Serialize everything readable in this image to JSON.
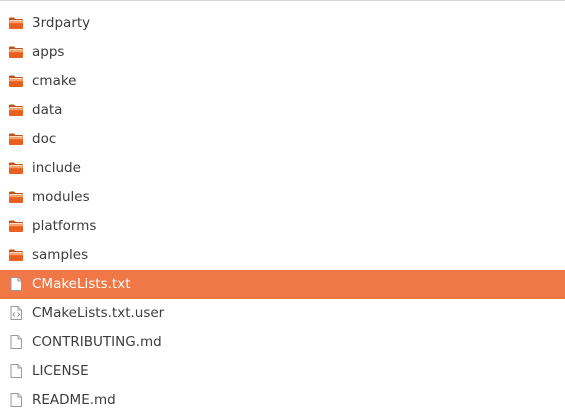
{
  "file_list": {
    "items": [
      {
        "name": "3rdparty",
        "type": "folder",
        "icon": "folder-icon",
        "selected": false
      },
      {
        "name": "apps",
        "type": "folder",
        "icon": "folder-icon",
        "selected": false
      },
      {
        "name": "cmake",
        "type": "folder",
        "icon": "folder-icon",
        "selected": false
      },
      {
        "name": "data",
        "type": "folder",
        "icon": "folder-icon",
        "selected": false
      },
      {
        "name": "doc",
        "type": "folder",
        "icon": "folder-icon",
        "selected": false
      },
      {
        "name": "include",
        "type": "folder",
        "icon": "folder-icon",
        "selected": false
      },
      {
        "name": "modules",
        "type": "folder",
        "icon": "folder-icon",
        "selected": false
      },
      {
        "name": "platforms",
        "type": "folder",
        "icon": "folder-icon",
        "selected": false
      },
      {
        "name": "samples",
        "type": "folder",
        "icon": "folder-icon",
        "selected": false
      },
      {
        "name": "CMakeLists.txt",
        "type": "text-file",
        "icon": "text-file-icon",
        "selected": true
      },
      {
        "name": "CMakeLists.txt.user",
        "type": "xml-file",
        "icon": "xml-file-icon",
        "selected": false
      },
      {
        "name": "CONTRIBUTING.md",
        "type": "text-file",
        "icon": "text-file-icon",
        "selected": false
      },
      {
        "name": "LICENSE",
        "type": "text-file",
        "icon": "text-file-icon",
        "selected": false
      },
      {
        "name": "README.md",
        "type": "text-file",
        "icon": "text-file-icon",
        "selected": false
      }
    ]
  },
  "colors": {
    "selection": "#f07746",
    "folder_top": "#f7a16b",
    "folder_body": "#e95f1f",
    "text": "#3c3c3c",
    "selected_text": "#ffffff"
  }
}
